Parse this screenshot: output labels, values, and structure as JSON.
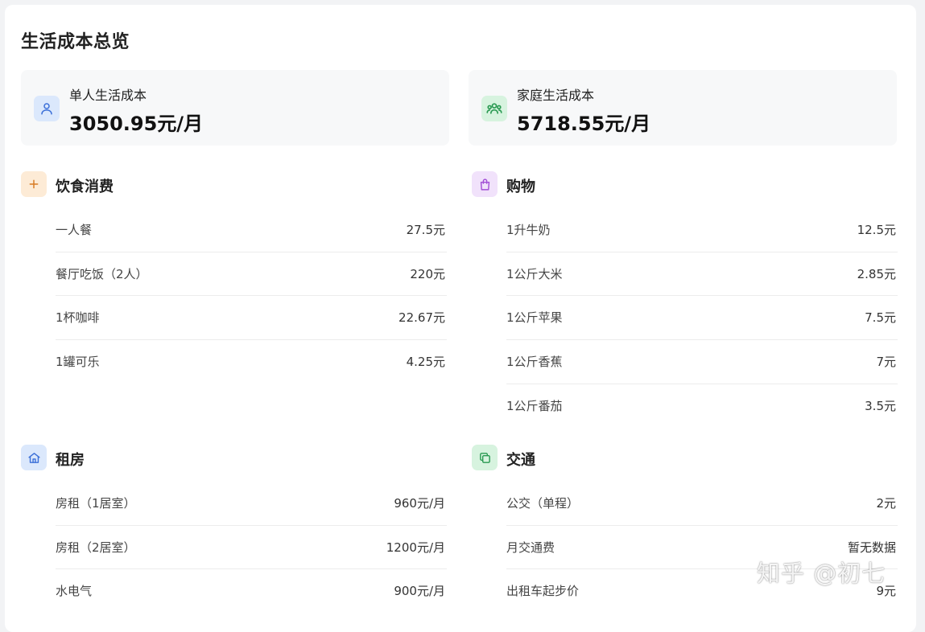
{
  "page": {
    "title": "生活成本总览"
  },
  "summary": {
    "single": {
      "label": "单人生活成本",
      "value": "3050.95元/月",
      "icon": "user-icon",
      "bg": "#dbe8fc",
      "fg": "#3b6fd8"
    },
    "family": {
      "label": "家庭生活成本",
      "value": "5718.55元/月",
      "icon": "users-icon",
      "bg": "#d7f3df",
      "fg": "#2a9a52"
    }
  },
  "sections": {
    "food": {
      "title": "饮食消费",
      "icon": "plus-icon",
      "bg": "#fdebd6",
      "fg": "#d77a22",
      "items": [
        {
          "name": "一人餐",
          "value": "27.5元"
        },
        {
          "name": "餐厅吃饭（2人）",
          "value": "220元"
        },
        {
          "name": "1杯咖啡",
          "value": "22.67元"
        },
        {
          "name": "1罐可乐",
          "value": "4.25元"
        }
      ]
    },
    "shopping": {
      "title": "购物",
      "icon": "shopping-bag-icon",
      "bg": "#f1e2fb",
      "fg": "#a24fd6",
      "items": [
        {
          "name": "1升牛奶",
          "value": "12.5元"
        },
        {
          "name": "1公斤大米",
          "value": "2.85元"
        },
        {
          "name": "1公斤苹果",
          "value": "7.5元"
        },
        {
          "name": "1公斤香蕉",
          "value": "7元"
        },
        {
          "name": "1公斤番茄",
          "value": "3.5元"
        }
      ]
    },
    "rent": {
      "title": "租房",
      "icon": "home-icon",
      "bg": "#dbe8fc",
      "fg": "#3b6fd8",
      "items": [
        {
          "name": "房租（1居室）",
          "value": "960元/月"
        },
        {
          "name": "房租（2居室）",
          "value": "1200元/月"
        },
        {
          "name": "水电气",
          "value": "900元/月"
        }
      ]
    },
    "transport": {
      "title": "交通",
      "icon": "copy-icon",
      "bg": "#d7f3df",
      "fg": "#2a9a52",
      "items": [
        {
          "name": "公交（单程）",
          "value": "2元"
        },
        {
          "name": "月交通费",
          "value": "暂无数据"
        },
        {
          "name": "出租车起步价",
          "value": "9元"
        }
      ]
    }
  },
  "watermark": "知乎 @初七"
}
